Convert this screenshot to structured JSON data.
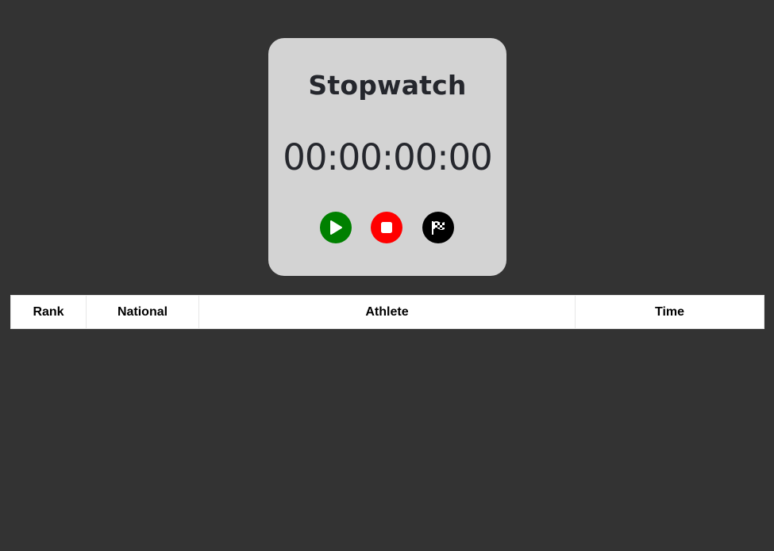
{
  "stopwatch": {
    "title": "Stopwatch",
    "time_display": "00:00:00:00",
    "buttons": {
      "start": {
        "icon": "play-icon",
        "color": "#008000"
      },
      "stop": {
        "icon": "stop-icon",
        "color": "#ff0000"
      },
      "lap": {
        "icon": "checkered-flag-icon",
        "color": "#000000"
      }
    }
  },
  "table": {
    "columns": [
      "Rank",
      "National",
      "Athlete",
      "Time"
    ],
    "rows": []
  },
  "colors": {
    "background": "#333333",
    "card": "#d3d3d3",
    "text": "#25272d"
  }
}
